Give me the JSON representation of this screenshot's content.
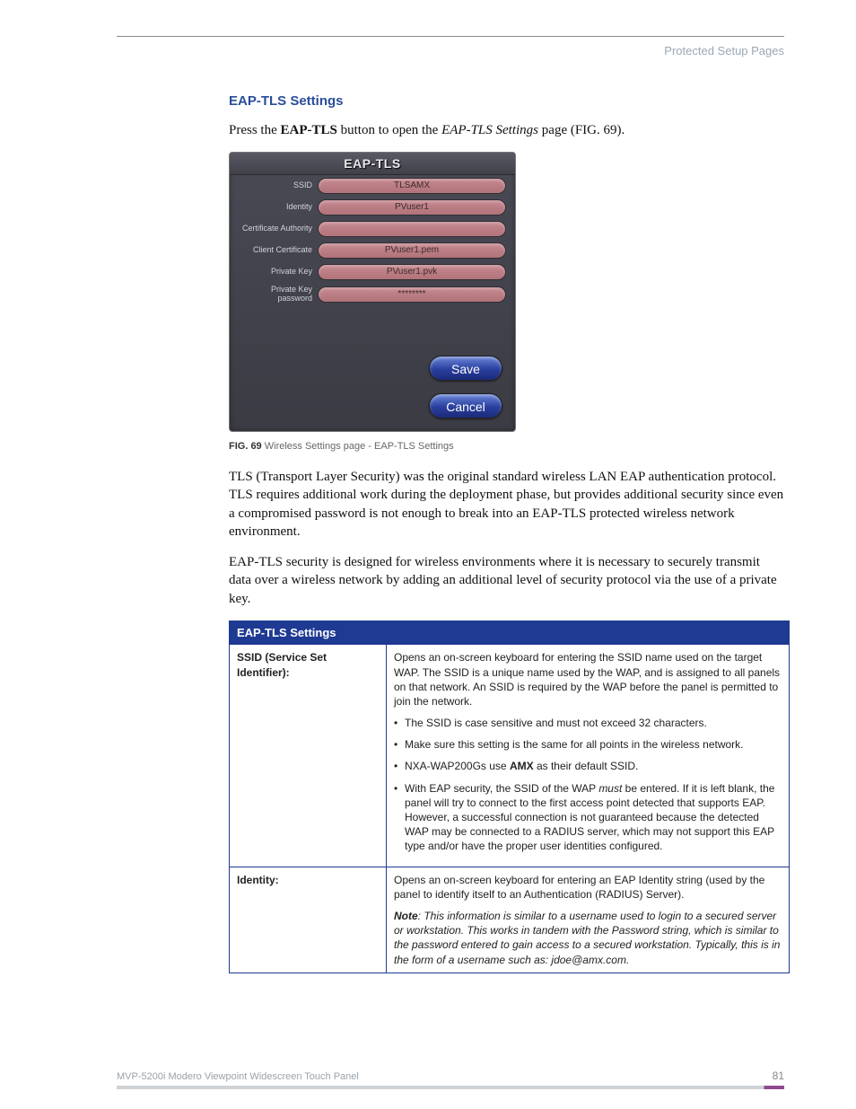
{
  "header": {
    "right_label": "Protected Setup Pages"
  },
  "section": {
    "heading": "EAP-TLS Settings"
  },
  "intro": {
    "prefix": "Press the ",
    "bold": "EAP-TLS",
    "mid": " button to open the ",
    "italic": "EAP-TLS Settings",
    "suffix": " page (FIG. 69)."
  },
  "figure": {
    "title": "EAP-TLS",
    "rows": [
      {
        "label": "SSID",
        "value": "TLSAMX"
      },
      {
        "label": "Identity",
        "value": "PVuser1"
      },
      {
        "label": "Certificate Authority",
        "value": ""
      },
      {
        "label": "Client Certificate",
        "value": "PVuser1.pem"
      },
      {
        "label": "Private Key",
        "value": "PVuser1.pvk"
      },
      {
        "label": "Private Key password",
        "value": "********"
      }
    ],
    "save_label": "Save",
    "cancel_label": "Cancel",
    "caption_bold": "FIG. 69",
    "caption_text": "  Wireless Settings page - EAP-TLS Settings"
  },
  "paragraphs": {
    "p1": "TLS (Transport Layer Security) was the original standard wireless LAN EAP authentication protocol. TLS requires additional work during the deployment phase, but provides additional security since even a compromised password is not enough to break into an EAP-TLS protected wireless network environment.",
    "p2": "EAP-TLS security is designed for wireless environments where it is necessary to securely transmit data over a wireless network by adding an additional level of security protocol via the use of a private key."
  },
  "table": {
    "title": "EAP-TLS Settings",
    "rows": [
      {
        "label": "SSID (Service Set Identifier):",
        "lead": "Opens an on-screen keyboard for entering the SSID name used on the target WAP. The SSID is a unique name used by the WAP, and is assigned to all panels on that network. An SSID is required by the WAP before the panel is permitted to join the network.",
        "bullets": [
          {
            "pre": "The SSID is case sensitive and must not exceed 32 characters."
          },
          {
            "pre": "Make sure this setting is the same for all points in the wireless network."
          },
          {
            "pre": "NXA-WAP200Gs use ",
            "bold": "AMX",
            "post": " as their default SSID."
          },
          {
            "pre": "With EAP security, the SSID of the WAP ",
            "ital": "must",
            "post": " be entered. If it is left blank, the panel will try to connect to the first access point detected that supports EAP. However, a successful connection is not guaranteed because the detected WAP may be connected to a RADIUS server, which may not support this EAP type and/or have the proper user identities configured."
          }
        ]
      },
      {
        "label": "Identity:",
        "lead": "Opens an on-screen keyboard for entering an EAP Identity string (used by the panel to identify itself to an Authentication (RADIUS) Server).",
        "note_bold": "Note",
        "note_text": ": This information is similar to a username used to login to a secured server or workstation. This works in tandem with the Password string, which is similar to the password entered to gain access to a secured workstation. Typically, this is in the form of a username such as: jdoe@amx.com."
      }
    ]
  },
  "footer": {
    "left": "MVP-5200i Modero Viewpoint Widescreen Touch Panel",
    "page": "81"
  }
}
